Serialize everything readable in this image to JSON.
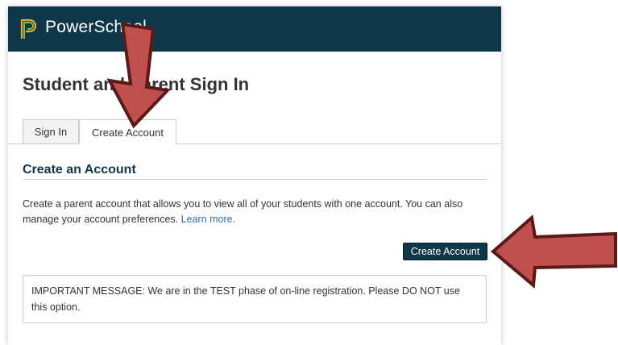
{
  "header": {
    "brand": "PowerSchool",
    "logo_icon": "powerschool-logo-icon"
  },
  "page_title": "Student and Parent Sign In",
  "tabs": [
    {
      "label": "Sign In",
      "active": false
    },
    {
      "label": "Create Account",
      "active": true
    }
  ],
  "section": {
    "title": "Create an Account",
    "description": "Create a parent account that allows you to view all of your students with one account. You can also manage your account preferences. ",
    "learn_more_link": "Learn more."
  },
  "create_button_label": "Create Account",
  "important_message": "IMPORTANT MESSAGE: We are in the TEST phase of on-line registration. Please DO NOT use this option.",
  "annotations": {
    "arrow_color": "#c0504d",
    "arrow_outline": "#5a1a18",
    "arrows": [
      "down-arrow-icon",
      "left-arrow-icon"
    ]
  },
  "colors": {
    "header_bg": "#0e3748",
    "button_bg": "#0e3748",
    "link": "#2e6da4"
  }
}
